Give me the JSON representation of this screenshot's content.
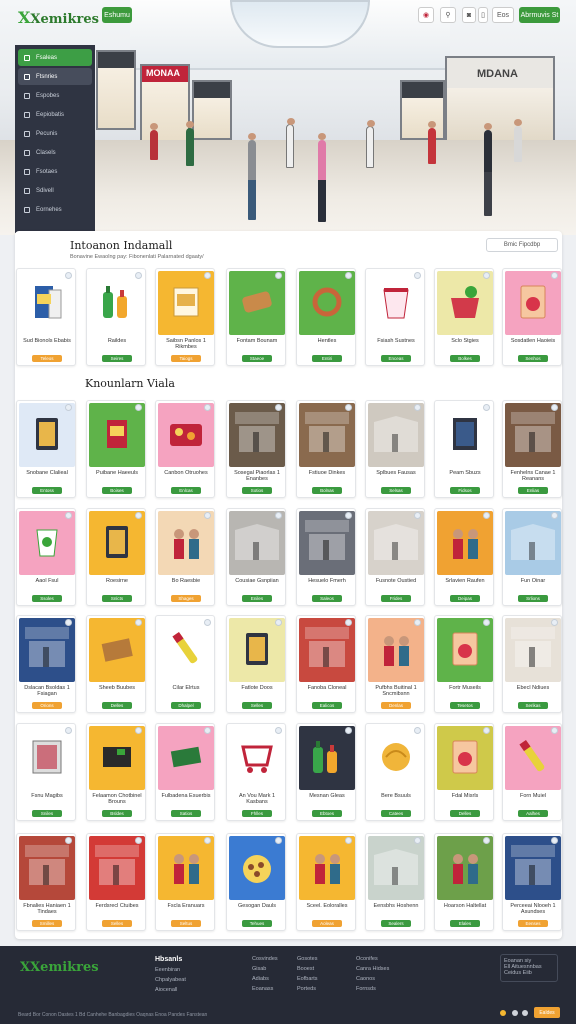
{
  "brand": "Xemikres",
  "topbar": {
    "left_button": "Eshumu",
    "right_button": "Abrmuvis St",
    "icon_buttons": [
      "pin-icon",
      "search-icon",
      "user-icon",
      "bag-icon"
    ],
    "cart_label": "Eos"
  },
  "hero": {
    "store_signs": [
      "MONAA",
      "MDANA"
    ]
  },
  "sidebar": {
    "items": [
      {
        "label": "Fsaleas",
        "state": "active"
      },
      {
        "label": "Ftsnries",
        "state": "selected"
      },
      {
        "label": "Espobes",
        "state": "normal"
      },
      {
        "label": "Eepiobatis",
        "state": "normal"
      },
      {
        "label": "Pecunis",
        "state": "normal"
      },
      {
        "label": "Clasels",
        "state": "normal"
      },
      {
        "label": "Fsotaes",
        "state": "normal"
      },
      {
        "label": "Sdivell",
        "state": "normal"
      },
      {
        "label": "Eornehes",
        "state": "normal"
      }
    ]
  },
  "section1": {
    "title": "Intoanon Indamall",
    "subtitle": "Bonavine Ewaolng pay: Fibonenlati Palarnated dgaaty/",
    "button": "Bmic Fipcdbp",
    "cards": [
      {
        "name": "Sud Bionols Ebabis",
        "btn": "Teleos",
        "bg": "#ffffff",
        "icon": "product-box-icon",
        "btn_color": "#f0a232"
      },
      {
        "name": "Raildes",
        "btn": "Seires",
        "bg": "#ffffff",
        "icon": "bottles-icon",
        "btn_color": "#3a9a3f"
      },
      {
        "name": "Saibsn Panlos 1 Rikmbes",
        "btn": "Taiogs",
        "bg": "#f5b731",
        "icon": "cereal-box-icon",
        "btn_color": "#f0a232"
      },
      {
        "name": "Fontam Bounam",
        "btn": "Staeoe",
        "bg": "#5fb34a",
        "icon": "bread-icon",
        "btn_color": "#3a9a3f"
      },
      {
        "name": "Hentles",
        "btn": "Entiri",
        "bg": "#5fb34a",
        "icon": "pretzel-icon",
        "btn_color": "#3a9a3f"
      },
      {
        "name": "Fsiash Sustnes",
        "btn": "Enceas",
        "bg": "#ffffff",
        "icon": "yogurt-cup-icon",
        "btn_color": "#3a9a3f"
      },
      {
        "name": "Sclo Stgies",
        "btn": "Bolkes",
        "bg": "#ede8a8",
        "icon": "basket-icon",
        "btn_color": "#3a9a3f"
      },
      {
        "name": "Sosdatlen Haoieis",
        "btn": "Senhos",
        "bg": "#f5a3c0",
        "icon": "snack-bag-icon",
        "btn_color": "#3a9a3f"
      }
    ]
  },
  "section2": {
    "title": "Knounlarn Viala",
    "rows": [
      [
        {
          "name": "Snobane Clalieal",
          "btn": "Entoss",
          "bg": "#dfe9f6",
          "icon": "tablet-icon",
          "btn_color": "#3a9a3f"
        },
        {
          "name": "Puibane Haeeuls",
          "btn": "Boises",
          "bg": "#5fb34a",
          "icon": "red-box-icon",
          "btn_color": "#3a9a3f"
        },
        {
          "name": "Canbon Otruohes",
          "btn": "Enlcas",
          "bg": "#f5a3c0",
          "icon": "tray-icon",
          "btn_color": "#3a9a3f"
        },
        {
          "name": "Sosegal Piaorlas 1 Enanbes",
          "btn": "Sotios",
          "bg": "#6b5b4a",
          "icon": "store-icon",
          "btn_color": "#3a9a3f"
        },
        {
          "name": "Fstiuoe Dinkes",
          "btn": "Bolnas",
          "bg": "#8a6a4e",
          "icon": "store-icon",
          "btn_color": "#3a9a3f"
        },
        {
          "name": "Splbues Fausas",
          "btn": "Selsas",
          "bg": "#cfc9c0",
          "icon": "mall-icon",
          "btn_color": "#3a9a3f"
        },
        {
          "name": "Peam Sbuzs",
          "btn": "Fidsos",
          "bg": "#ffffff",
          "icon": "display-icon",
          "btn_color": "#3a9a3f"
        },
        {
          "name": "Fenhelns Canae 1 Reanans",
          "btn": "Enlias",
          "bg": "#7a5a44",
          "icon": "store-icon",
          "btn_color": "#3a9a3f"
        }
      ],
      [
        {
          "name": "Aaol Fsul",
          "btn": "Ssoles",
          "bg": "#f5a3c0",
          "icon": "cup-icon",
          "btn_color": "#3a9a3f"
        },
        {
          "name": "Roesirne",
          "btn": "Snlcts",
          "bg": "#f5b731",
          "icon": "tablet-icon",
          "btn_color": "#3a9a3f"
        },
        {
          "name": "Bo Raesbie",
          "btn": "Shages",
          "bg": "#f3d8b5",
          "icon": "people-icon",
          "btn_color": "#f0a232"
        },
        {
          "name": "Cousiae Gsnpiian",
          "btn": "Eniles",
          "bg": "#b8b6b2",
          "icon": "mall-icon",
          "btn_color": "#3a9a3f"
        },
        {
          "name": "Hesuelo Fmerh",
          "btn": "Saleos",
          "bg": "#6a6e78",
          "icon": "store-icon",
          "btn_color": "#3a9a3f"
        },
        {
          "name": "Fusnote Oustied",
          "btn": "Frides",
          "bg": "#d7d2cb",
          "icon": "mall-icon",
          "btn_color": "#3a9a3f"
        },
        {
          "name": "Srlavien Raufen",
          "btn": "Deipas",
          "bg": "#f0a232",
          "icon": "people-icon",
          "btn_color": "#3a9a3f"
        },
        {
          "name": "Fun Oinar",
          "btn": "Srlions",
          "bg": "#a9cbe6",
          "icon": "mall-icon",
          "btn_color": "#3a9a3f"
        }
      ],
      [
        {
          "name": "Dslacan Bsoldas 1 Fsiagan",
          "btn": "Orions",
          "bg": "#2d4f8a",
          "icon": "store-icon",
          "btn_color": "#f0a232"
        },
        {
          "name": "Sheeb Buubes",
          "btn": "Delles",
          "bg": "#f5b731",
          "icon": "box-icon",
          "btn_color": "#3a9a3f"
        },
        {
          "name": "Cilar Elrtus",
          "btn": "Dhalpel",
          "bg": "#ffffff",
          "icon": "marker-icon",
          "btn_color": "#3a9a3f"
        },
        {
          "name": "Fatlote Doos",
          "btn": "Selles",
          "bg": "#ede8a8",
          "icon": "tablet-icon",
          "btn_color": "#3a9a3f"
        },
        {
          "name": "Fanoba Cloneal",
          "btn": "Ealicos",
          "bg": "#c8493f",
          "icon": "store-icon",
          "btn_color": "#3a9a3f"
        },
        {
          "name": "Pufbhs Buitinal 1 Sncmibsnn",
          "btn": "Denlas",
          "bg": "#f3b28a",
          "icon": "people-icon",
          "btn_color": "#f0a232"
        },
        {
          "name": "Fortr Museils",
          "btn": "Tesetos",
          "bg": "#5fb34a",
          "icon": "snack-bag-icon",
          "btn_color": "#3a9a3f"
        },
        {
          "name": "Ebecl Ndiues",
          "btn": "Serikas",
          "bg": "#e7e1d8",
          "icon": "store-icon",
          "btn_color": "#3a9a3f"
        }
      ],
      [
        {
          "name": "Fsnu Magibs",
          "btn": "Sniles",
          "bg": "#ffffff",
          "icon": "door-icon",
          "btn_color": "#3a9a3f"
        },
        {
          "name": "Felaamon Chotbinel Brouns",
          "btn": "Bsldes",
          "bg": "#f5b731",
          "icon": "dark-box-icon",
          "btn_color": "#3a9a3f"
        },
        {
          "name": "Fulbadena Esuerbis",
          "btn": "Satios",
          "bg": "#f5a3c0",
          "icon": "green-box-icon",
          "btn_color": "#3a9a3f"
        },
        {
          "name": "An Vou Mark 1 Kasbans",
          "btn": "Fhlles",
          "bg": "#ffffff",
          "icon": "cart-icon",
          "btn_color": "#3a9a3f"
        },
        {
          "name": "Mesnan Gleas",
          "btn": "Ebtoes",
          "bg": "#2f3442",
          "icon": "bottles-icon",
          "btn_color": "#3a9a3f"
        },
        {
          "name": "Bere Bsuuls",
          "btn": "Catees",
          "bg": "#ffffff",
          "icon": "banana-icon",
          "btn_color": "#3a9a3f"
        },
        {
          "name": "Fdal Misrls",
          "btn": "Delles",
          "bg": "#cfc94a",
          "icon": "snack-bag-icon",
          "btn_color": "#3a9a3f"
        },
        {
          "name": "Forn Muiel",
          "btn": "Aalhes",
          "bg": "#f5a3c0",
          "icon": "marker-icon",
          "btn_color": "#3a9a3f"
        }
      ],
      [
        {
          "name": "Fbnalies Haniaen 1 Tindaes",
          "btn": "Smilles",
          "bg": "#b5483a",
          "icon": "store-icon",
          "btn_color": "#f0a232"
        },
        {
          "name": "Ferdsrecl Ctuibes",
          "btn": "Selles",
          "bg": "#d33a36",
          "icon": "store-icon",
          "btn_color": "#f0a232"
        },
        {
          "name": "Fscla Eranuars",
          "btn": "Seltus",
          "bg": "#f5b731",
          "icon": "people-icon",
          "btn_color": "#f0a232"
        },
        {
          "name": "Gesogan Dauls",
          "btn": "Tehues",
          "bg": "#3b7bd2",
          "icon": "food-icon",
          "btn_color": "#3a9a3f"
        },
        {
          "name": "Sceel. Eoloralles",
          "btn": "Aoleas",
          "bg": "#f5b731",
          "icon": "people-icon",
          "btn_color": "#f0a232"
        },
        {
          "name": "Eensbhs Hoshenn",
          "btn": "Sealers",
          "bg": "#c9d3cc",
          "icon": "mall-icon",
          "btn_color": "#3a9a3f"
        },
        {
          "name": "Hoarson Haltellat",
          "btn": "Elales",
          "bg": "#6da04a",
          "icon": "people-icon",
          "btn_color": "#3a9a3f"
        },
        {
          "name": "Perceeai Nlooeh 1 Asundses",
          "btn": "Eenses",
          "bg": "#2d4f8a",
          "icon": "store-icon",
          "btn_color": "#f0a232"
        }
      ]
    ]
  },
  "footer": {
    "brand": "Xemikres",
    "col1_head": "Hbsanls",
    "col1": [
      "Eeenbiran",
      "Chpalyabeat",
      "Aiocenall"
    ],
    "col2": [
      "Cosvindes",
      "Gisab",
      "Adiabs",
      "Eoanass"
    ],
    "col3": [
      "Gosotes",
      "Booest",
      "Eofbarts",
      "Porteds"
    ],
    "col4": [
      "Oconifes",
      "Canra Hidses",
      "Caonos",
      "Fornsds"
    ],
    "box": [
      "Eoanan siy",
      "Ell Aituesnnbas",
      "Ceidus Eiib"
    ],
    "bottom_text": "Beard Bor Conon Dastes 1 Bd Canhehe Banbagdies Oaqnas Enoa Pandes Fanstean",
    "cta": "Ealdes"
  }
}
